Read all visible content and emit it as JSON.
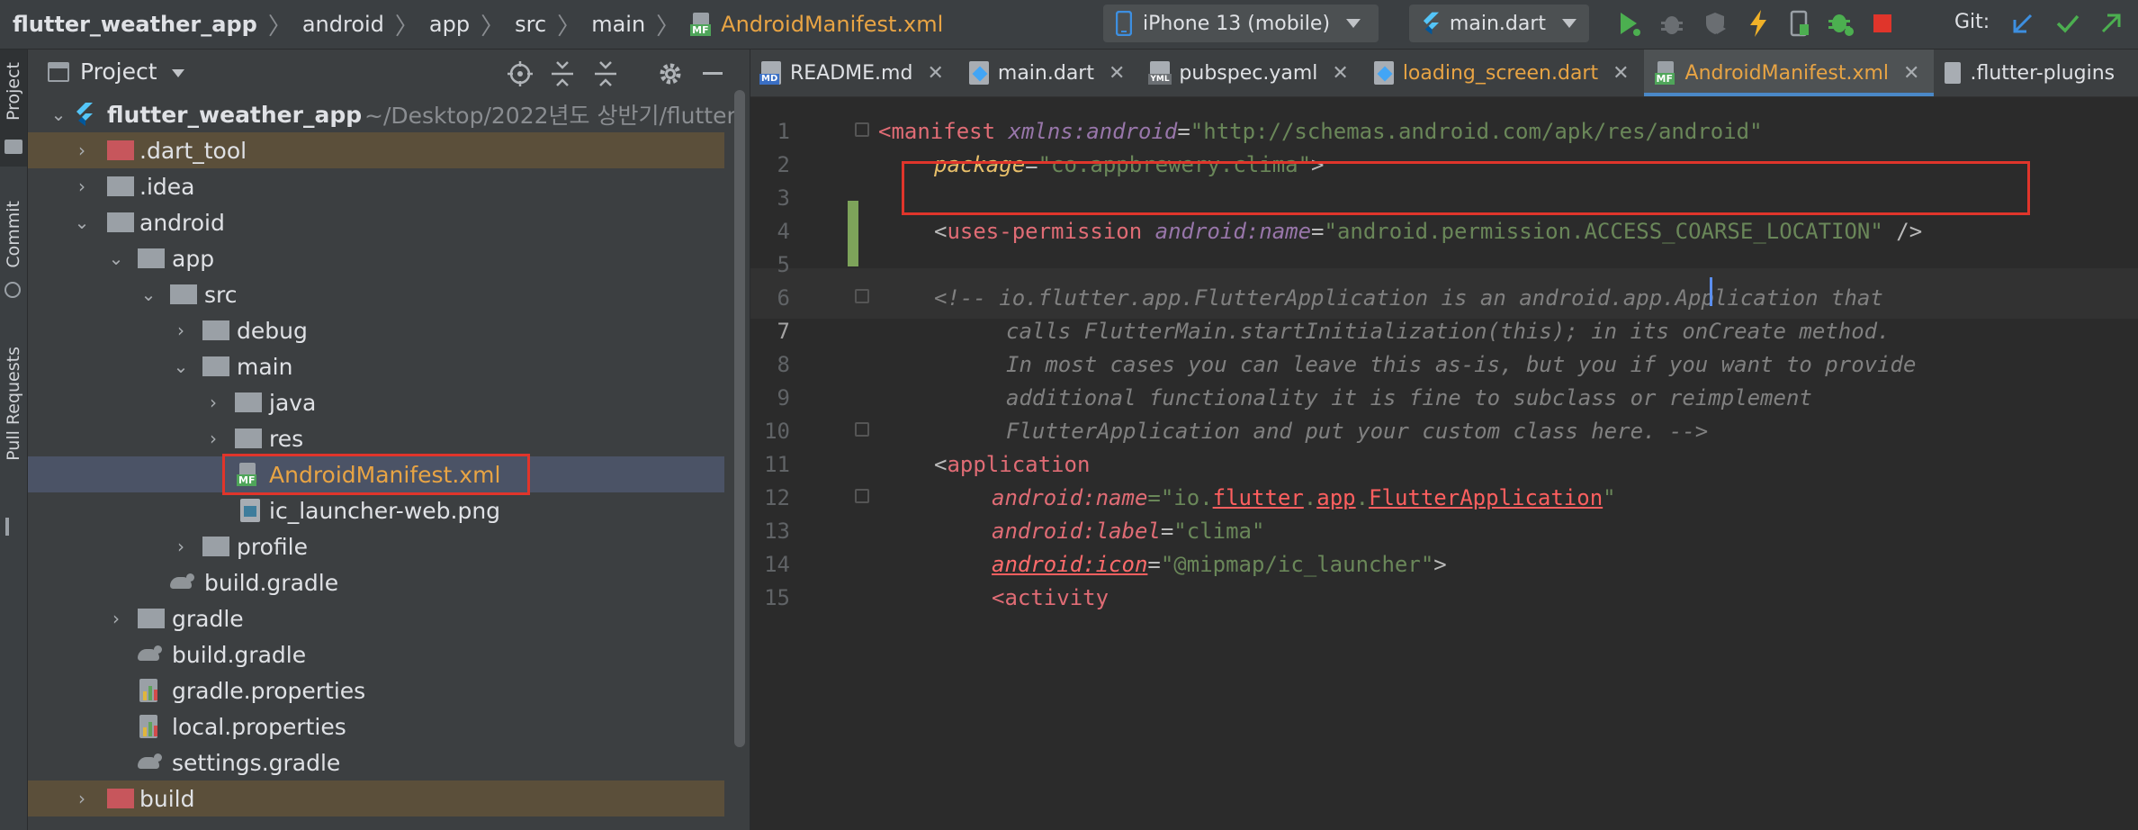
{
  "topbar": {
    "breadcrumbs": [
      "flutter_weather_app",
      "android",
      "app",
      "src",
      "main"
    ],
    "current_file": "AndroidManifest.xml",
    "device": "iPhone 13 (mobile)",
    "run_config": "main.dart",
    "git_label": "Git:"
  },
  "strip": {
    "project": "Project",
    "commit": "Commit",
    "pull_requests": "Pull Requests"
  },
  "project_panel": {
    "title": "Project",
    "root_name": "flutter_weather_app",
    "root_path": "~/Desktop/2022년도 상반기/flutter",
    "items": [
      {
        "label": ".dart_tool"
      },
      {
        "label": ".idea"
      },
      {
        "label": "android"
      },
      {
        "label": "app"
      },
      {
        "label": "src"
      },
      {
        "label": "debug"
      },
      {
        "label": "main"
      },
      {
        "label": "java"
      },
      {
        "label": "res"
      },
      {
        "label": "AndroidManifest.xml"
      },
      {
        "label": "ic_launcher-web.png"
      },
      {
        "label": "profile"
      },
      {
        "label": "build.gradle"
      },
      {
        "label": "gradle"
      },
      {
        "label": "build.gradle"
      },
      {
        "label": "gradle.properties"
      },
      {
        "label": "local.properties"
      },
      {
        "label": "settings.gradle"
      },
      {
        "label": "build"
      }
    ]
  },
  "editor": {
    "tabs": [
      {
        "label": "README.md"
      },
      {
        "label": "main.dart"
      },
      {
        "label": "pubspec.yaml"
      },
      {
        "label": "loading_screen.dart"
      },
      {
        "label": "AndroidManifest.xml"
      },
      {
        "label": ".flutter-plugins"
      }
    ],
    "line_numbers": [
      "1",
      "2",
      "3",
      "4",
      "5",
      "6",
      "7",
      "8",
      "9",
      "10",
      "11",
      "12",
      "13",
      "14",
      "15"
    ],
    "code": {
      "l1_tag": "<manifest",
      "l1_ns": "xmlns:android",
      "l1_eq": "=",
      "l1_val": "\"http://schemas.android.com/apk/res/android\"",
      "l2_attr": "package",
      "l2_eq": "=",
      "l2_val": "\"co.appbrewery.clima\"",
      "l2_end": ">",
      "l4_open": "<",
      "l4_tag": "uses-permission",
      "l4_ns": "android:name",
      "l4_eq": "=",
      "l4_val": "\"android.permission.ACCESS_COARSE_LOCATION\"",
      "l4_close": " />",
      "l6": "<!-- io.flutter.app.FlutterApplication is an android.app.Application that",
      "l7": "calls FlutterMain.startInitialization(this); in its onCreate method.",
      "l8": "In most cases you can leave this as-is, but you if you want to provide",
      "l9": "additional functionality it is fine to subclass or reimplement",
      "l10": "FlutterApplication and put your custom class here. -->",
      "l11_open": "<",
      "l11_tag": "application",
      "l12_ns": "android:name",
      "l12_eq": "=\"io.",
      "l12_e1": "flutter",
      "l12_dot1": ".",
      "l12_e2": "app",
      "l12_dot2": ".",
      "l12_e3": "FlutterApplication",
      "l12_q": "\"",
      "l13_ns": "android:label",
      "l13_eq": "=",
      "l13_val": "\"clima\"",
      "l14_ns": "android:icon",
      "l14_eq": "=",
      "l14_val": "\"@mipmap/ic_launcher\"",
      "l14_end": ">",
      "l15": "<activity"
    }
  },
  "colors": {
    "highlight_box": "#e0352b",
    "accent_tab": "#4a88c7"
  }
}
